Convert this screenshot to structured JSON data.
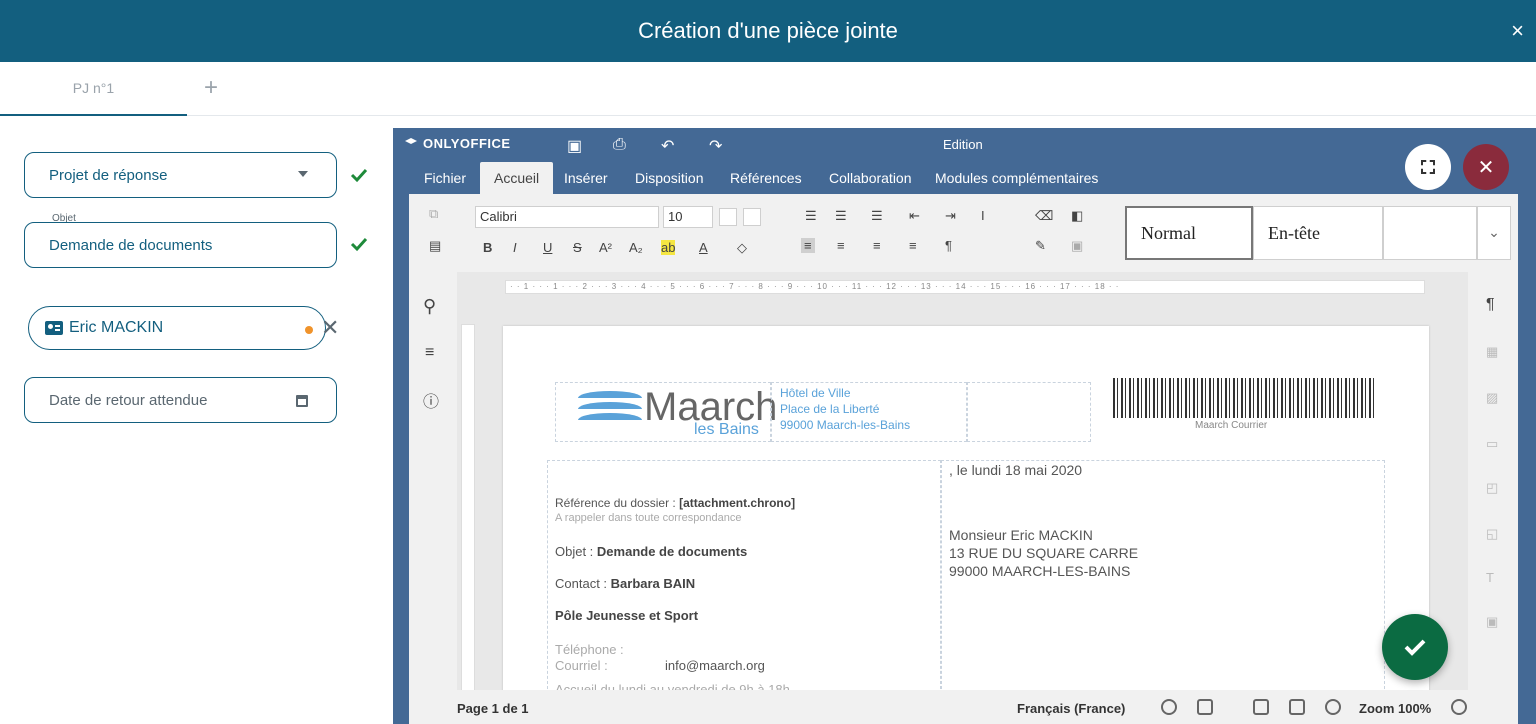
{
  "modal": {
    "title": "Création d'une pièce jointe",
    "close_symbol": "×"
  },
  "tabs": {
    "items": [
      {
        "label": "PJ n°1"
      }
    ],
    "add_symbol": "+"
  },
  "form": {
    "type_value": "Projet de réponse",
    "object_label": "Objet",
    "object_value": "Demande de documents",
    "contact_name": "Eric MACKIN",
    "return_date_placeholder": "Date de retour attendue"
  },
  "editor": {
    "brand": "ONLYOFFICE",
    "mode": "Edition",
    "menu": [
      "Fichier",
      "Accueil",
      "Insérer",
      "Disposition",
      "Références",
      "Collaboration",
      "Modules complémentaires"
    ],
    "active_menu": "Accueil",
    "font_name": "Calibri",
    "font_size": "10",
    "styles": [
      "Normal",
      "En-tête"
    ],
    "ruler_text": "· · 1 · · · 1 · · · 2 · · · 3 · · · 4 · · · 5 · · · 6 · · · 7 · · · 8 · · · 9 · · · 10 · · · 11 · · · 12 · · · 13 · · · 14 · · · 15 · · · 16 · · · 17 · · · 18 · ·",
    "status": {
      "page": "Page 1 de 1",
      "language": "Français (France)",
      "zoom": "Zoom 100%"
    }
  },
  "document": {
    "logo_main": "Maarch",
    "logo_sub": "les Bains",
    "sender_address": [
      "Hôtel de Ville",
      "Place de la Liberté",
      "99000 Maarch-les-Bains"
    ],
    "barcode_label": "Maarch Courrier",
    "date_line": ", le lundi 18 mai 2020",
    "ref_label": "Référence du dossier : ",
    "ref_value": "[attachment.chrono]",
    "ref_hint": "A rappeler dans toute correspondance",
    "object_label": "Objet : ",
    "object_value": "Demande de documents",
    "contact_label": "Contact : ",
    "contact_value": "Barbara BAIN",
    "department": "Pôle Jeunesse et Sport",
    "phone_label": "Téléphone :",
    "mail_label": "Courriel :",
    "mail_value": "info@maarch.org",
    "hours": "Accueil du lundi au vendredi de 9h à 18h",
    "recipient": [
      "Monsieur Eric MACKIN",
      "13 RUE DU SQUARE CARRE",
      "99000 MAARCH-LES-BAINS"
    ]
  },
  "colors": {
    "header": "#135f7f",
    "editor_chrome": "#446995",
    "confirm": "#0b6b42",
    "close_red": "#8a2b3c",
    "valid_check": "#1e8a3a"
  },
  "icons": [
    "close-icon",
    "add-icon",
    "dropdown-caret-icon",
    "check-icon",
    "contact-card-icon",
    "remove-icon",
    "calendar-icon",
    "save-icon",
    "print-icon",
    "undo-icon",
    "redo-icon",
    "fullscreen-icon",
    "search-icon",
    "paragraph-icon",
    "info-icon",
    "globe-icon",
    "zoom-out-icon",
    "zoom-in-icon",
    "confirm-check-icon"
  ]
}
